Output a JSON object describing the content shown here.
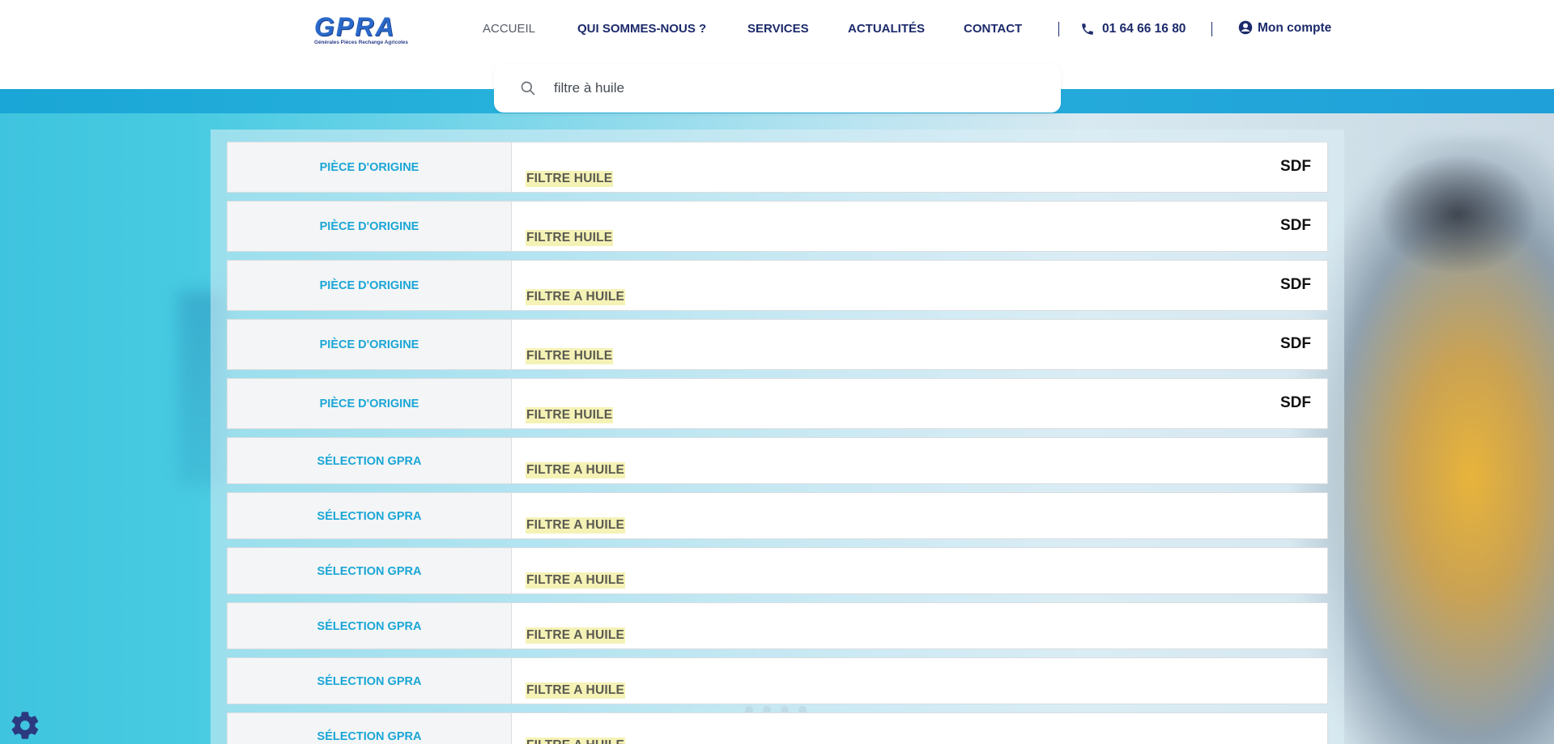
{
  "header": {
    "logo_text": "GPRA",
    "logo_subtext": "Générales Pièces Rechange Agricoles",
    "nav": [
      {
        "label": "ACCUEIL"
      },
      {
        "label": "QUI SOMMES-NOUS ?"
      },
      {
        "label": "SERVICES"
      },
      {
        "label": "ACTUALITÉS"
      },
      {
        "label": "CONTACT"
      }
    ],
    "phone": "01 64 66 16 80",
    "account_label": "Mon compte",
    "colors": {
      "nav": "#1c2a6b",
      "accent": "#1aa6d6"
    }
  },
  "search": {
    "value": "filtre à huile",
    "icon": "search-icon"
  },
  "results": [
    {
      "category": "PIÈCE D'ORIGINE",
      "title": "FILTRE HUILE",
      "brand": "SDF"
    },
    {
      "category": "PIÈCE D'ORIGINE",
      "title": "FILTRE HUILE",
      "brand": "SDF"
    },
    {
      "category": "PIÈCE D'ORIGINE",
      "title": "FILTRE A HUILE",
      "brand": "SDF"
    },
    {
      "category": "PIÈCE D'ORIGINE",
      "title": "FILTRE HUILE",
      "brand": "SDF"
    },
    {
      "category": "PIÈCE D'ORIGINE",
      "title": "FILTRE HUILE",
      "brand": "SDF"
    },
    {
      "category": "SÉLECTION GPRA",
      "title": "FILTRE A HUILE",
      "brand": ""
    },
    {
      "category": "SÉLECTION GPRA",
      "title": "FILTRE A HUILE",
      "brand": ""
    },
    {
      "category": "SÉLECTION GPRA",
      "title": "FILTRE A HUILE",
      "brand": ""
    },
    {
      "category": "SÉLECTION GPRA",
      "title": "FILTRE A HUILE",
      "brand": ""
    },
    {
      "category": "SÉLECTION GPRA",
      "title": "FILTRE A HUILE",
      "brand": ""
    },
    {
      "category": "SÉLECTION GPRA",
      "title": "FILTRE A HUILE",
      "brand": ""
    }
  ],
  "floating": {
    "settings_icon": "gear-icon"
  }
}
